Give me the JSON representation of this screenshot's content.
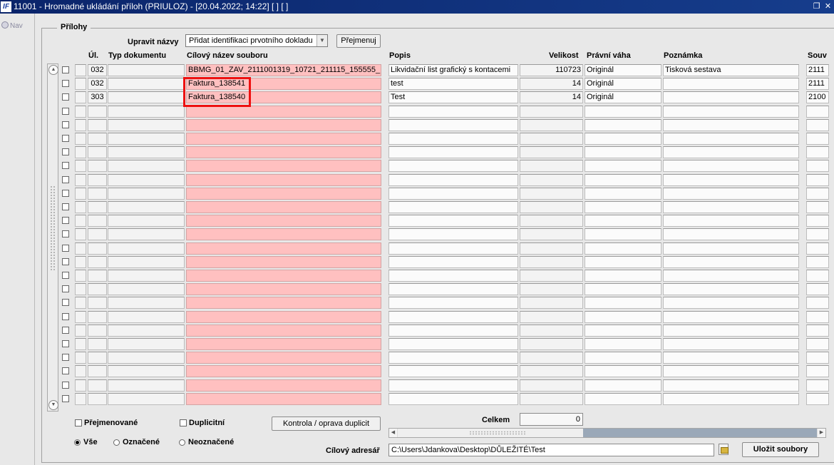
{
  "window": {
    "title": "11001 - Hromadné ukládání příloh (PRIULOZ) - [20.04.2022; 14:22]  [ ]  [ ]",
    "app_icon_text": "IF",
    "restore_glyph": "❐",
    "close_glyph": "✕"
  },
  "nav": {
    "label": "Nav"
  },
  "section": {
    "title": "Přílohy"
  },
  "toolbar": {
    "rename_label": "Upravit názvy",
    "rename_mode_value": "Přidat identifikaci prvotního dokladu",
    "rename_button": "Přejmenuj"
  },
  "columns": {
    "ul": "Úl.",
    "doc_type": "Typ dokumentu",
    "target_name": "Cílový název souboru",
    "description": "Popis",
    "size": "Velikost",
    "legal_weight": "Právní váha",
    "note": "Poznámka",
    "related": "Souv"
  },
  "rows": [
    {
      "ul": "032",
      "doc_type": "",
      "target_name": "BBMG_01_ZAV_2111001319_10721_211115_155555_",
      "description": "Likvidační list grafický s kontacemi",
      "size": "110723",
      "legal_weight": "Originál",
      "note": "Tisková sestava",
      "related": "2111"
    },
    {
      "ul": "032",
      "doc_type": "",
      "target_name": "Faktura_138541",
      "description": "test",
      "size": "14",
      "legal_weight": "Originál",
      "note": "",
      "related": "2111"
    },
    {
      "ul": "303",
      "doc_type": "",
      "target_name": "Faktura_138540",
      "description": "Test",
      "size": "14",
      "legal_weight": "Originál",
      "note": "",
      "related": "2100"
    }
  ],
  "empty_row_count": 22,
  "footer": {
    "renamed_label": "Přejmenované",
    "duplicates_label": "Duplicitní",
    "check_duplicates_button": "Kontrola / oprava duplicit",
    "total_label": "Celkem",
    "total_value": "0",
    "filter": {
      "all": "Vše",
      "marked": "Označené",
      "unmarked": "Neoznačené",
      "selected": "all"
    },
    "target_dir_label": "Cílový adresář",
    "target_dir_value": "C:\\Users\\Jdankova\\Desktop\\DŮLEŽITÉ\\Test",
    "save_button": "Uložit soubory"
  },
  "colors": {
    "pink_cell": "#ffc0c0",
    "highlight": "#ee1111",
    "titlebar": "#0a246a"
  }
}
